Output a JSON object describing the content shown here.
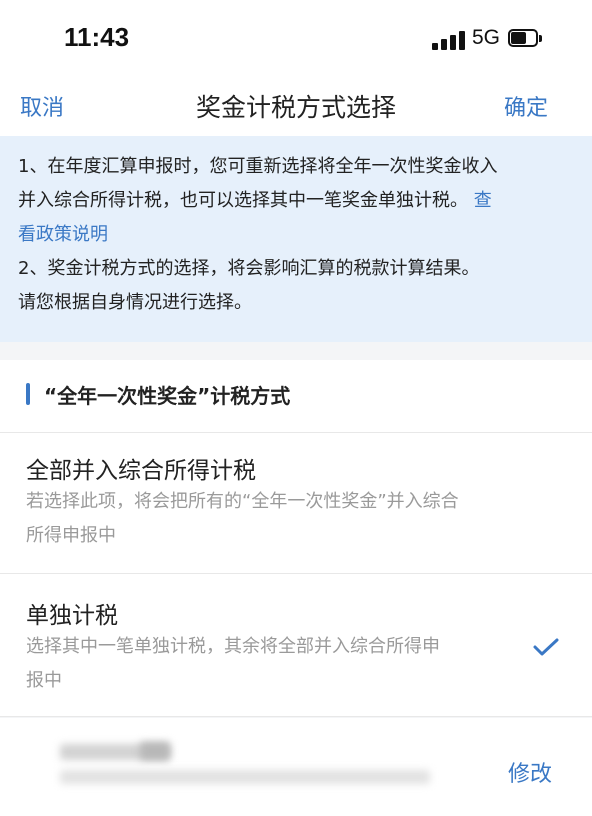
{
  "status_bar": {
    "time": "11:43",
    "network": "5G",
    "icons": [
      "signal-icon",
      "battery-icon"
    ]
  },
  "nav": {
    "cancel_label": "取消",
    "title": "奖金计税方式选择",
    "confirm_label": "确定"
  },
  "notice": {
    "line1": "1、在年度汇算申报时，您可重新选择将全年一次性奖金收入",
    "line2_text": "并入综合所得计税，也可以选择其中一笔奖金单独计税。",
    "line2_link": "查",
    "line3_link": "看政策说明",
    "line4": "2、奖金计税方式的选择，将会影响汇算的税款计算结果。",
    "line5": "请您根据自身情况进行选择。"
  },
  "section": {
    "title": "“全年一次性奖金”计税方式"
  },
  "options": [
    {
      "title": "全部并入综合所得计税",
      "desc_line1": "若选择此项，将会把所有的“全年一次性奖金”并入综合",
      "desc_line2": "所得申报中",
      "selected": false
    },
    {
      "title": "单独计税",
      "desc_line1": "选择其中一笔单独计税，其余将全部并入综合所得申",
      "desc_line2": "报中",
      "selected": true
    }
  ],
  "account_row": {
    "modify_label": "修改"
  },
  "colors": {
    "accent": "#3a78c5",
    "notice_bg": "#e6f0fb",
    "page_bg": "#f4f5f7",
    "muted_text": "#9a9a9a"
  }
}
